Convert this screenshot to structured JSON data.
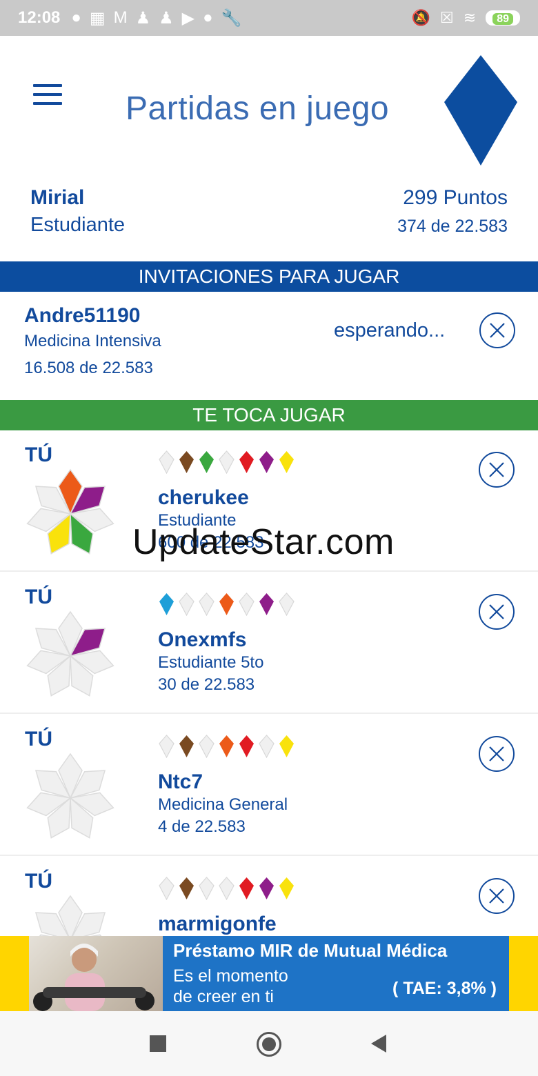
{
  "status_bar": {
    "time": "12:08",
    "battery": "89"
  },
  "header": {
    "title": "Partidas en juego"
  },
  "user": {
    "name": "Mirial",
    "level": "Estudiante",
    "points": "299 Puntos",
    "rank": "374 de 22.583"
  },
  "invitations": {
    "title": "INVITACIONES PARA JUGAR",
    "items": [
      {
        "name": "Andre51190",
        "specialty": "Medicina Intensiva",
        "rank": "16.508 de 22.583",
        "status": "esperando..."
      }
    ]
  },
  "turn": {
    "title": "TE TOCA JUGAR",
    "games": [
      {
        "you_label": "TÚ",
        "name": "cherukee",
        "specialty": "Estudiante",
        "rank": "600 de 22.583",
        "gems": [
          "empty",
          "brown",
          "green",
          "empty",
          "red",
          "purple",
          "yellow"
        ],
        "petals": [
          "orange",
          "purple",
          "empty",
          "green",
          "yellow",
          "empty",
          "empty"
        ]
      },
      {
        "you_label": "TÚ",
        "name": "Onexmfs",
        "specialty": "Estudiante 5to",
        "rank": "30 de 22.583",
        "gems": [
          "blue",
          "empty",
          "empty",
          "orange",
          "empty",
          "purple",
          "empty"
        ],
        "petals": [
          "empty",
          "purple",
          "empty",
          "empty",
          "empty",
          "empty",
          "empty"
        ]
      },
      {
        "you_label": "TÚ",
        "name": "Ntc7",
        "specialty": "Medicina General",
        "rank": "4 de 22.583",
        "gems": [
          "empty",
          "brown",
          "empty",
          "orange",
          "red",
          "empty",
          "yellow"
        ],
        "petals": [
          "empty",
          "empty",
          "empty",
          "empty",
          "empty",
          "empty",
          "empty"
        ]
      },
      {
        "you_label": "TÚ",
        "name": "marmigonfe",
        "specialty": "",
        "rank": "",
        "gems": [
          "empty",
          "brown",
          "empty",
          "empty",
          "red",
          "purple",
          "yellow"
        ],
        "petals": [
          "empty",
          "empty",
          "empty",
          "empty",
          "empty",
          "empty",
          "empty"
        ]
      }
    ]
  },
  "watermark": "UpdateStar.com",
  "ad": {
    "title": "Préstamo MIR de Mutual Médica",
    "line1": "Es el momento",
    "line2": "de creer en ti",
    "rate": "( TAE: 3,8% )"
  },
  "colors": {
    "primary": "#124a9c",
    "invite_bar": "#0c4d9f",
    "turn_bar": "#3a9a42",
    "empty": "#f0f0f0",
    "brown": "#7a4a21",
    "green": "#3aa83f",
    "red": "#e11b22",
    "purple": "#8e1d8a",
    "yellow": "#f9e20c",
    "orange": "#ec5a19",
    "blue": "#1e9fd8"
  }
}
